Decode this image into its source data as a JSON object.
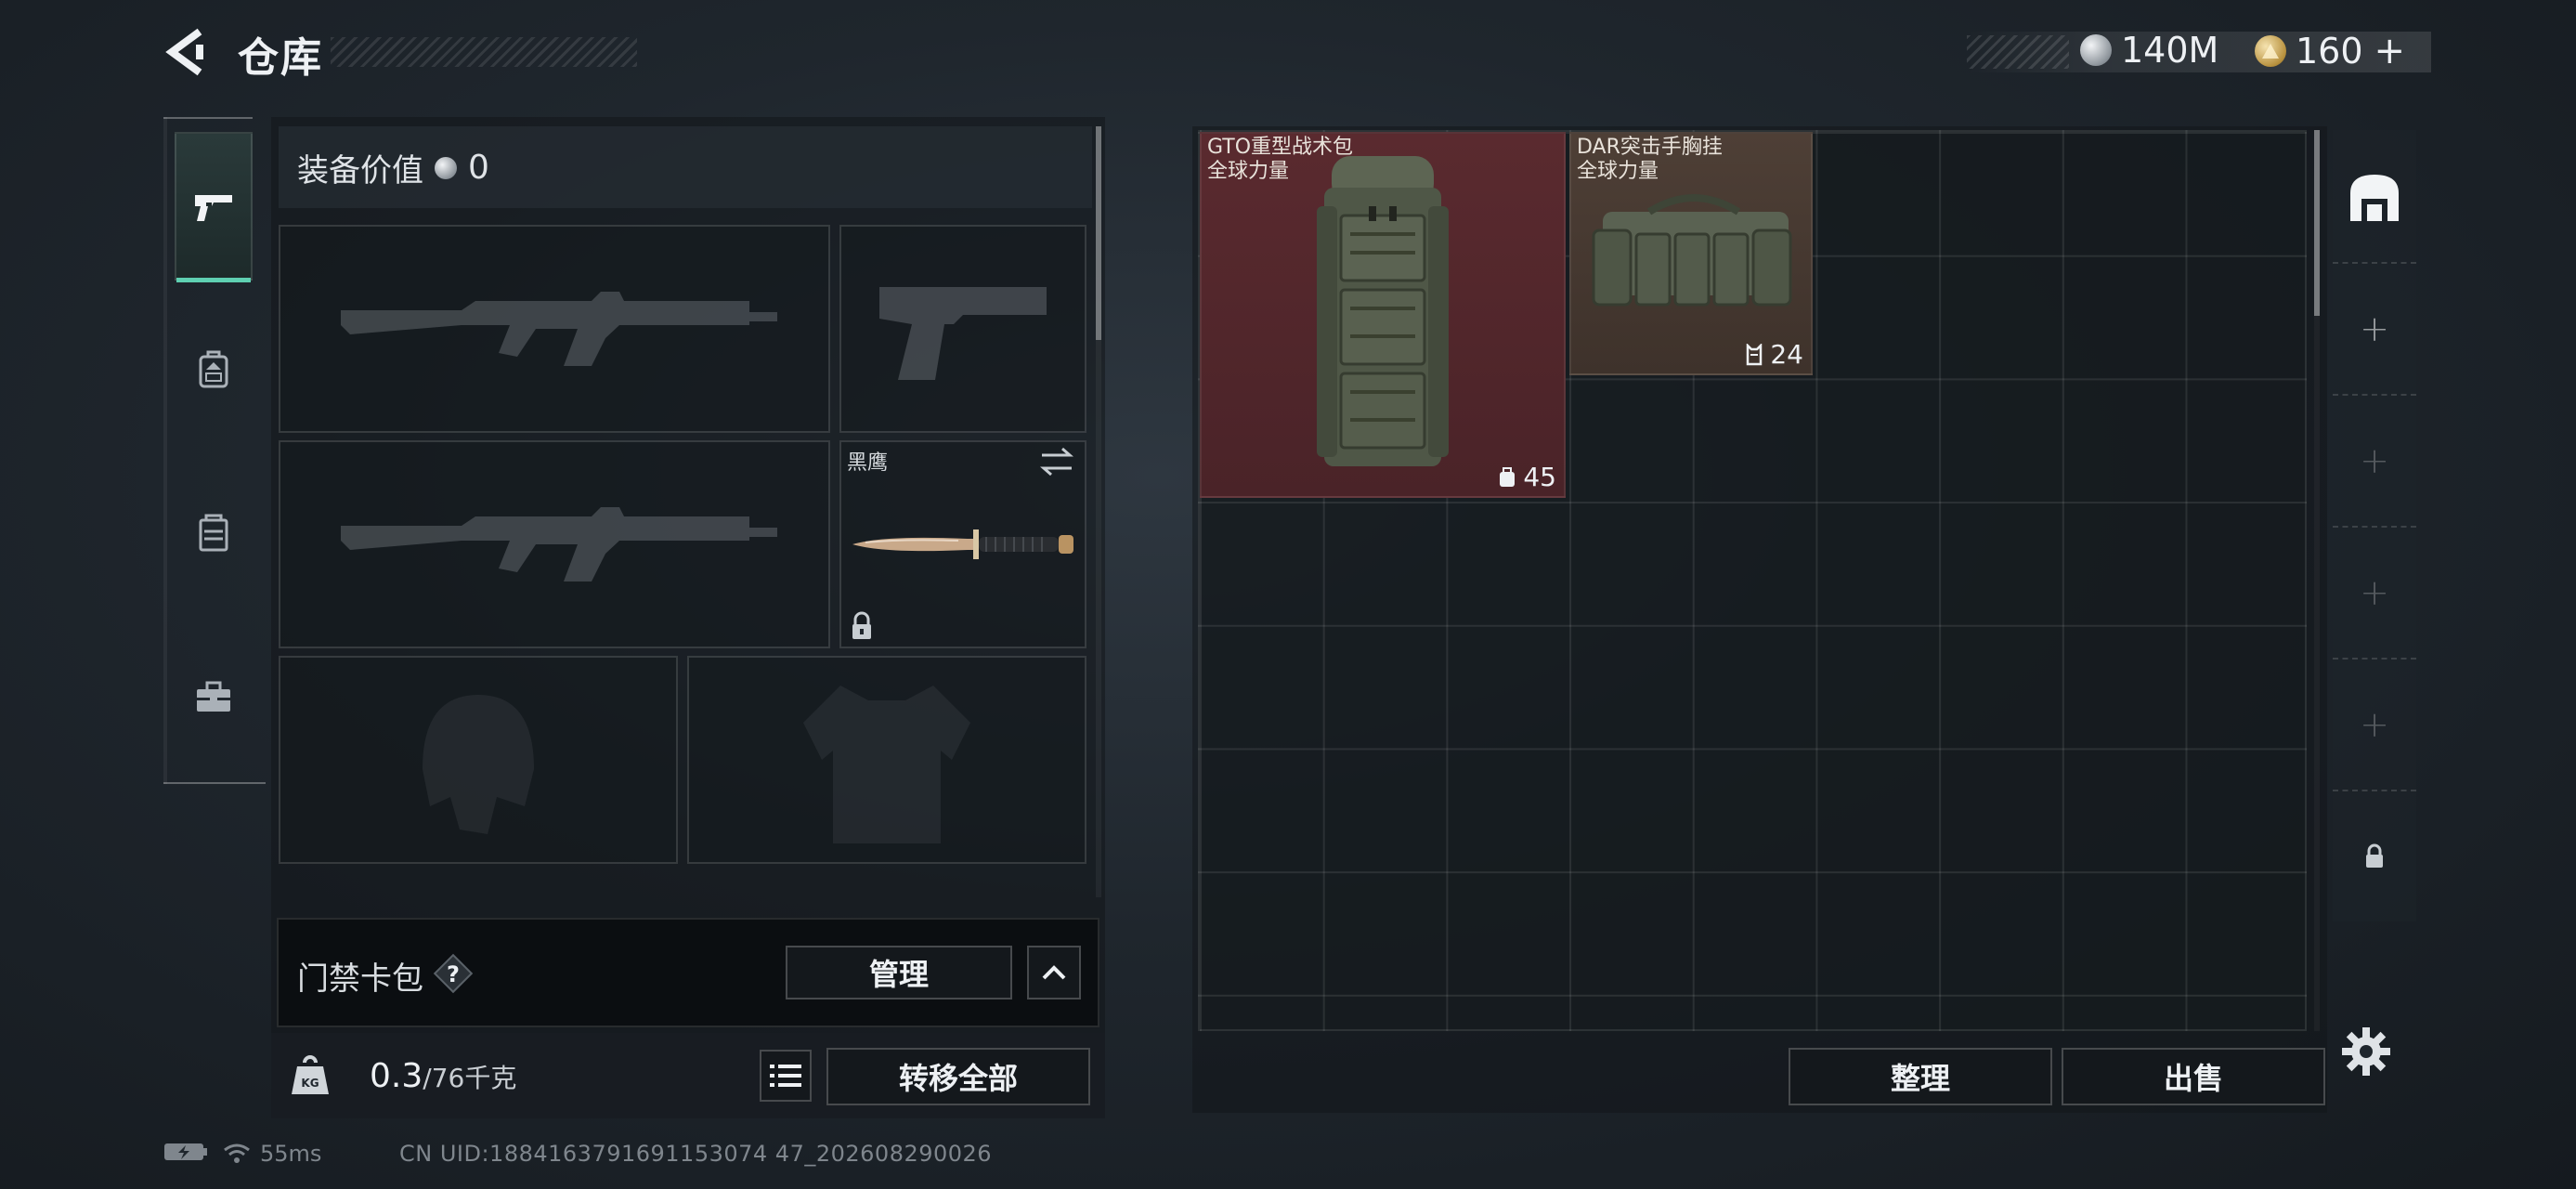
{
  "header": {
    "title": "仓库",
    "currency": {
      "silver": "140M",
      "gold": "160",
      "gold_add": "+"
    }
  },
  "nav": {
    "items": [
      {
        "name": "weapons",
        "icon": "pistol-icon",
        "active": true
      },
      {
        "name": "backpack",
        "icon": "backpack-icon",
        "active": false
      },
      {
        "name": "vest",
        "icon": "vest-icon",
        "active": false
      },
      {
        "name": "toolbox",
        "icon": "toolbox-icon",
        "active": false
      }
    ]
  },
  "equipment": {
    "value_label": "装备价值",
    "value": "0",
    "knife_name": "黑鹰",
    "slots": [
      {
        "type": "primary-weapon",
        "icon": "rifle-silhouette"
      },
      {
        "type": "pistol",
        "icon": "pistol-silhouette"
      },
      {
        "type": "secondary-weapon",
        "icon": "rifle-silhouette"
      },
      {
        "type": "melee",
        "icon": "knife-icon"
      },
      {
        "type": "helmet",
        "icon": "helmet-silhouette"
      },
      {
        "type": "armor",
        "icon": "armor-silhouette"
      }
    ],
    "access_card": {
      "label": "门禁卡包",
      "help": "?",
      "manage_label": "管理"
    },
    "weight": {
      "current": "0.3",
      "max": "/76千克",
      "kg_icon_text": "KG"
    },
    "transfer_all_label": "转移全部"
  },
  "storage": {
    "items": [
      {
        "name": "GTO重型战术包",
        "brand": "全球力量",
        "stat": "45",
        "stat_icon": "backpack-capacity-icon",
        "color": "#5a2a2f"
      },
      {
        "name": "DAR突击手胸挂",
        "brand": "全球力量",
        "stat": "24",
        "stat_icon": "vest-capacity-icon",
        "color": "#4e3f36"
      }
    ],
    "sort_label": "整理",
    "sell_label": "出售"
  },
  "sidebar": {
    "slots": [
      "home-icon",
      "plus",
      "plus",
      "plus",
      "plus",
      "lock-icon"
    ]
  },
  "status_bar": {
    "ping": "55ms",
    "uid": "CN UID:1884163791691153074 47_202608290026"
  },
  "colors": {
    "accent": "#5fd0b2",
    "backpack_bg": "#5a2a2f",
    "vest_bg": "#4e3f36"
  }
}
